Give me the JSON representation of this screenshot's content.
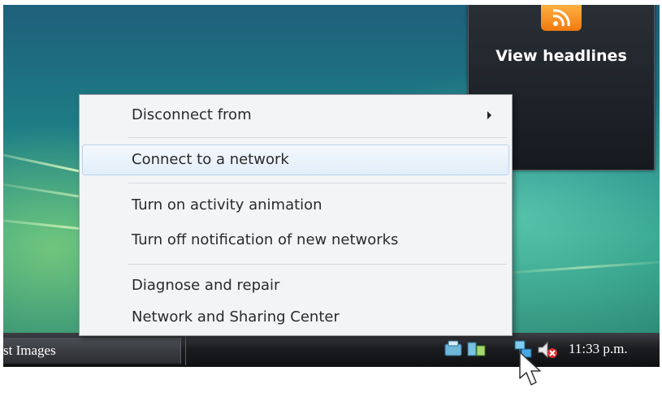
{
  "gadget": {
    "title": "View headlines",
    "icon": "rss-feed-icon"
  },
  "context_menu": {
    "items": [
      {
        "label": "Disconnect from",
        "has_submenu": true,
        "highlighted": false
      },
      {
        "label": "Connect to a network",
        "has_submenu": false,
        "highlighted": true
      },
      {
        "label": "Turn on activity animation",
        "has_submenu": false,
        "highlighted": false
      },
      {
        "label": "Turn off notification of new networks",
        "has_submenu": false,
        "highlighted": false
      },
      {
        "label": "Diagnose and repair",
        "has_submenu": false,
        "highlighted": false
      },
      {
        "label": "Network and Sharing Center",
        "has_submenu": false,
        "highlighted": false
      }
    ]
  },
  "taskbar": {
    "task_button_label": "st Images",
    "clock": "11:33 p.m.",
    "tray_icons": [
      "program-tray-icon",
      "printer-tray-icon",
      "network-tray-icon",
      "volume-muted-tray-icon"
    ]
  },
  "colors": {
    "menu_background": "#f3f4f6",
    "menu_highlight": "#e2eefa",
    "taskbar": "#1c1d20",
    "rss_orange": "#f07a10"
  }
}
